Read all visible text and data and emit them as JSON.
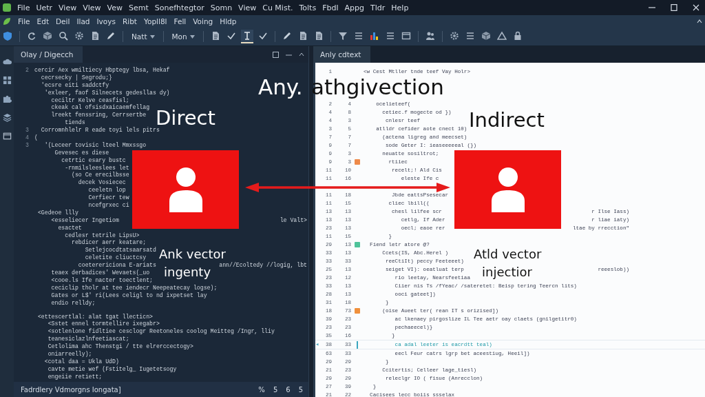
{
  "title_bar": {
    "menu": [
      "File",
      "Uetr",
      "View",
      "Vlew",
      "Vew",
      "Semt",
      "Sonefhtegtor",
      "Somn",
      "View",
      "Cu Mist.",
      "Tolts",
      "Fbdl",
      "Appg",
      "Tldr",
      "Help"
    ]
  },
  "menu_bar": {
    "items": [
      "File",
      "Edt",
      "Deil",
      "Ilad",
      "Ivoys",
      "Ribt",
      "Yopll8l",
      "Fell",
      "Voing",
      "Hldp"
    ]
  },
  "toolbar": {
    "items": [
      {
        "kind": "icon",
        "selected": false
      },
      {
        "kind": "separator"
      },
      {
        "kind": "icon",
        "selected": false
      },
      {
        "kind": "icon",
        "selected": false
      },
      {
        "kind": "icon",
        "selected": false
      },
      {
        "kind": "icon",
        "selected": false
      },
      {
        "kind": "icon",
        "selected": false
      },
      {
        "kind": "icon",
        "selected": false
      },
      {
        "kind": "separator"
      },
      {
        "kind": "dropdown",
        "label": "Natt",
        "selected": false
      },
      {
        "kind": "separator"
      },
      {
        "kind": "dropdown",
        "label": "Mon",
        "selected": false
      },
      {
        "kind": "separator"
      },
      {
        "kind": "icon",
        "selected": false
      },
      {
        "kind": "icon",
        "selected": false
      },
      {
        "kind": "icon",
        "selected": true
      },
      {
        "kind": "icon",
        "selected": false
      },
      {
        "kind": "separator"
      },
      {
        "kind": "icon",
        "selected": false
      },
      {
        "kind": "icon",
        "selected": false
      },
      {
        "kind": "icon",
        "selected": false
      },
      {
        "kind": "separator"
      },
      {
        "kind": "icon",
        "selected": false
      },
      {
        "kind": "icon",
        "selected": false
      },
      {
        "kind": "icon",
        "selected": false
      },
      {
        "kind": "icon",
        "selected": false
      },
      {
        "kind": "icon",
        "selected": false
      },
      {
        "kind": "separator"
      },
      {
        "kind": "icon",
        "selected": false
      },
      {
        "kind": "separator"
      },
      {
        "kind": "icon",
        "selected": false
      },
      {
        "kind": "icon",
        "selected": false
      },
      {
        "kind": "icon",
        "selected": false
      },
      {
        "kind": "icon",
        "selected": false
      },
      {
        "kind": "icon",
        "selected": false
      }
    ]
  },
  "left_pane": {
    "tab": {
      "label": "Olay / Digecch"
    },
    "lines": [
      {
        "num": "2",
        "text": "cercir Aex wmiltiecy Hbptegy lbsa, Hekaf"
      },
      {
        "text": "  cecrsecky | Segrodu;}"
      },
      {
        "text": "  'ecsre eiti saddctfy"
      },
      {
        "text": "   'exleer, faof Silnecets gedesllas dy)"
      },
      {
        "text": "     ceciltr Kelve ceasfisl;"
      },
      {
        "text": "     ckeak cal ofsisdxaicaemfellag"
      },
      {
        "text": "     lreekt fenssring, Cerrsertbe"
      },
      {
        "text": "         tiends"
      },
      {
        "num": "3",
        "text": "  Corromnhlelr R eade toyi lels pitrs"
      },
      {
        "num": "4",
        "text": "("
      },
      {
        "num": "3",
        "text": "   '(Leceer tovisic lteel Mmxssgo"
      },
      {
        "text": "      Gevesec es diese"
      },
      {
        "text": "        cetrtic esary bustc"
      },
      {
        "text": "         -rnmilsleeslees let"
      },
      {
        "text": "           (so Ce erecilbsse"
      },
      {
        "text": "             decek Vosiecec"
      },
      {
        "text": "                ceeletn lop"
      },
      {
        "text": "                Cerfiecr tew"
      },
      {
        "text": "                ncefgrxec ci"
      },
      {
        "text": " <Gedeoe llly"
      },
      {
        "text": "     <esseliecer Ingetiom",
        "tail": "le Valt>"
      },
      {
        "text": "       esactet"
      },
      {
        "text": "         cedlesr tetrile LipsU>"
      },
      {
        "text": "           rebdicer aerr keatare;"
      },
      {
        "text": "               Setlejcocdtatsaarsatd"
      },
      {
        "text": "               celetite cliuctcsy"
      },
      {
        "text": "             coeterericiona E-ariats",
        "tail": "ann//Ecoltedy //logig, lbt"
      },
      {
        "text": "     teaex derbadices' Wevaets(_uo"
      },
      {
        "text": "     <cooe.ls Ife nacter toectlent;"
      },
      {
        "text": "     ceciclip tholr at tee iendecr Neepeatecay logse);"
      },
      {
        "text": "     Gates or L$' ri(Lees celigl to nd ixpetset lay"
      },
      {
        "text": "     endio relldy;"
      },
      {
        "text": " <ettescertlal: alat tgat llecticn>",
        "gap_before": true
      },
      {
        "text": "    <Sstet ennel tormtellire ixegabr>"
      },
      {
        "text": "    <sotlenlone fidltiee cesclogr Reetoneles coolog Meitteg /Ingr, lliy"
      },
      {
        "text": "    teanesiclazlnfeetiascat;"
      },
      {
        "text": "    Cetlolima ahc Thenstgi / tte elrerccectogy>"
      },
      {
        "text": "    oniarreelly);"
      },
      {
        "text": "   <cotal daa = Ukla UdD)"
      },
      {
        "text": "    cavte metie wef (Fstitelg_ Iugetetsogy"
      },
      {
        "text": "    engeiie retiett;"
      }
    ],
    "status_bar": {
      "text": "Fadrdlery Vdmorgns Iongata]",
      "indicators": [
        "%",
        "5",
        "6",
        "5"
      ]
    }
  },
  "right_pane": {
    "tab": {
      "label": "Anly cdtext"
    },
    "lines": [
      {
        "n1": "1",
        "text": "<w Cest Mtller tnde teef Vay Holr>"
      },
      {
        "n1": "2",
        "n2": "4",
        "text": "    ocelieteef(",
        "gap_before": true
      },
      {
        "n1": "4",
        "n2": "8",
        "text": "      cetiec.f mogecte od })"
      },
      {
        "n1": "4",
        "n2": "3",
        "text": "       cnlesr teef"
      },
      {
        "n1": "3",
        "n2": "5",
        "text": "    atlldr cefider aote cnect 10)"
      },
      {
        "n1": "7",
        "n2": "7",
        "text": "      (actena ligreg and meecset)"
      },
      {
        "n1": "9",
        "n2": "7",
        "text": "       sode Geter I: ieaseeeeeal (})"
      },
      {
        "n1": "9",
        "n2": "3",
        "text": "      neuatte sosiltrot;"
      },
      {
        "n1": "9",
        "n2": "3",
        "text": "        rtiiec",
        "marker": {
          "kind": "square",
          "color": "#ee8a4a"
        }
      },
      {
        "n1": "11",
        "n2": "10",
        "text": "         recelt;! Ald Cis"
      },
      {
        "n1": "11",
        "n2": "16",
        "text": "            eleste Ife c"
      },
      {
        "n1": "11",
        "n2": "18",
        "text": "         Jbde eattsPsesecar",
        "covered_before": true
      },
      {
        "n1": "11",
        "n2": "15",
        "text": "        cliec lbill(("
      },
      {
        "n1": "13",
        "n2": "13",
        "text": "         chesl lilfee scr",
        "tail": "r Ilse Iass)"
      },
      {
        "n1": "13",
        "n2": "13",
        "text": "            cetlg, If Ader",
        "tail": "r liae iaty)"
      },
      {
        "n1": "23",
        "n2": "13",
        "text": "            oecl; eaoe rer",
        "tail": "ltae by rrecction\""
      },
      {
        "n1": "11",
        "n2": "15",
        "text": "        }"
      },
      {
        "n1": "29",
        "n2": "13",
        "text": "  Fiend letr atore @?",
        "marker": {
          "kind": "square",
          "color": "#4fc39a"
        }
      },
      {
        "n1": "33",
        "n2": "13",
        "text": "      Ccets(IS, Abc.Herel )"
      },
      {
        "n1": "33",
        "n2": "33",
        "text": "       reeCtiIt) peccy Feeteeet)"
      },
      {
        "n1": "25",
        "n2": "13",
        "text": "       seiget VI): oeatluat terp",
        "tail": "reeeslob))"
      },
      {
        "n1": "23",
        "n2": "12",
        "text": "          rio leetay, Nearsfeetiaa"
      },
      {
        "n1": "33",
        "n2": "13",
        "text": "          Ciier nis Ts /fYeac/ /sateretet: Beisp tering Teercn lits)"
      },
      {
        "n1": "28",
        "n2": "13",
        "text": "          ooci gateet])"
      },
      {
        "n1": "31",
        "n2": "18",
        "text": "       }"
      },
      {
        "n1": "18",
        "n2": "73",
        "text": "      (oise Aueet ter( rean IT s orizised])",
        "marker": {
          "kind": "square",
          "color": "#f0903c"
        }
      },
      {
        "n1": "39",
        "n2": "23",
        "text": "          ac lkenaey pirgoslize IL Tee aetr oay claets (gnilgetitr0)"
      },
      {
        "n1": "23",
        "n2": "23",
        "text": "          pechaeecel)}"
      },
      {
        "n1": "35",
        "n2": "16",
        "text": "         }"
      },
      {
        "n1": "38",
        "n2": "33",
        "text": "          ca adal leeter is eacrdtt teal)",
        "current": true,
        "pointer": "◂",
        "marker": {
          "kind": "bar",
          "color": "#3aa6c0"
        }
      },
      {
        "n1": "63",
        "n2": "33",
        "text": "          eecl Feur catrs lgrp bet aceestiug, Heeil])"
      },
      {
        "n1": "29",
        "n2": "29",
        "text": "       }"
      },
      {
        "n1": "21",
        "n2": "23",
        "text": "      Ccitertis; Celleer lage_tiesl)"
      },
      {
        "n1": "29",
        "n2": "29",
        "text": "       releclgr IO ( fisue (Anrecclon)"
      },
      {
        "n1": "27",
        "n2": "39",
        "text": "   }"
      },
      {
        "n1": "21",
        "n2": "22",
        "text": "  Cacisees lecc boiis ssselax"
      }
    ]
  },
  "diagram": {
    "heading": [
      "Any.",
      "athgivection"
    ],
    "nodes": [
      {
        "label": "Direct",
        "caption": [
          "Ank vector",
          "ingenty"
        ]
      },
      {
        "label": "Indirect",
        "caption": [
          "Atld vector",
          "injectior"
        ]
      }
    ]
  }
}
